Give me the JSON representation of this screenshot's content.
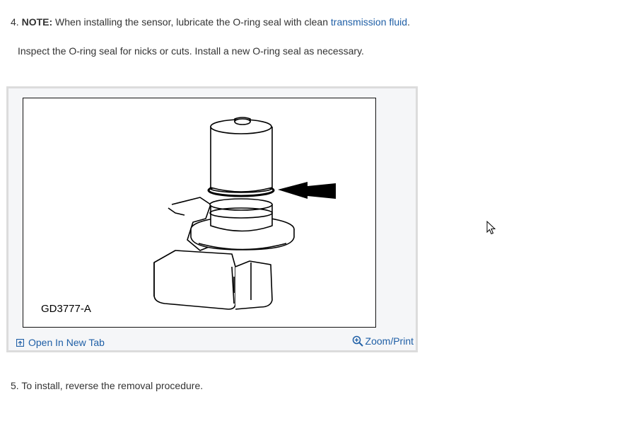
{
  "step4": {
    "number": "4.",
    "note_label": "NOTE:",
    "text": "When installing the sensor, lubricate the O-ring seal with clean",
    "link_text": "transmission fluid",
    "trailing": ".",
    "subtext": "Inspect the O-ring seal for nicks or cuts. Install a new O-ring seal as necessary."
  },
  "figure": {
    "label": "GD3777-A",
    "open_tab_label": "Open In New Tab",
    "zoom_label": "Zoom/Print",
    "icons": {
      "open_tab": "open-new-tab-icon",
      "zoom": "zoom-in-icon"
    }
  },
  "step5": {
    "number": "5.",
    "text": "To install, reverse the removal procedure."
  },
  "colors": {
    "link": "#1f5fa6",
    "text": "#333333",
    "figure_border": "#dcdcdc"
  }
}
